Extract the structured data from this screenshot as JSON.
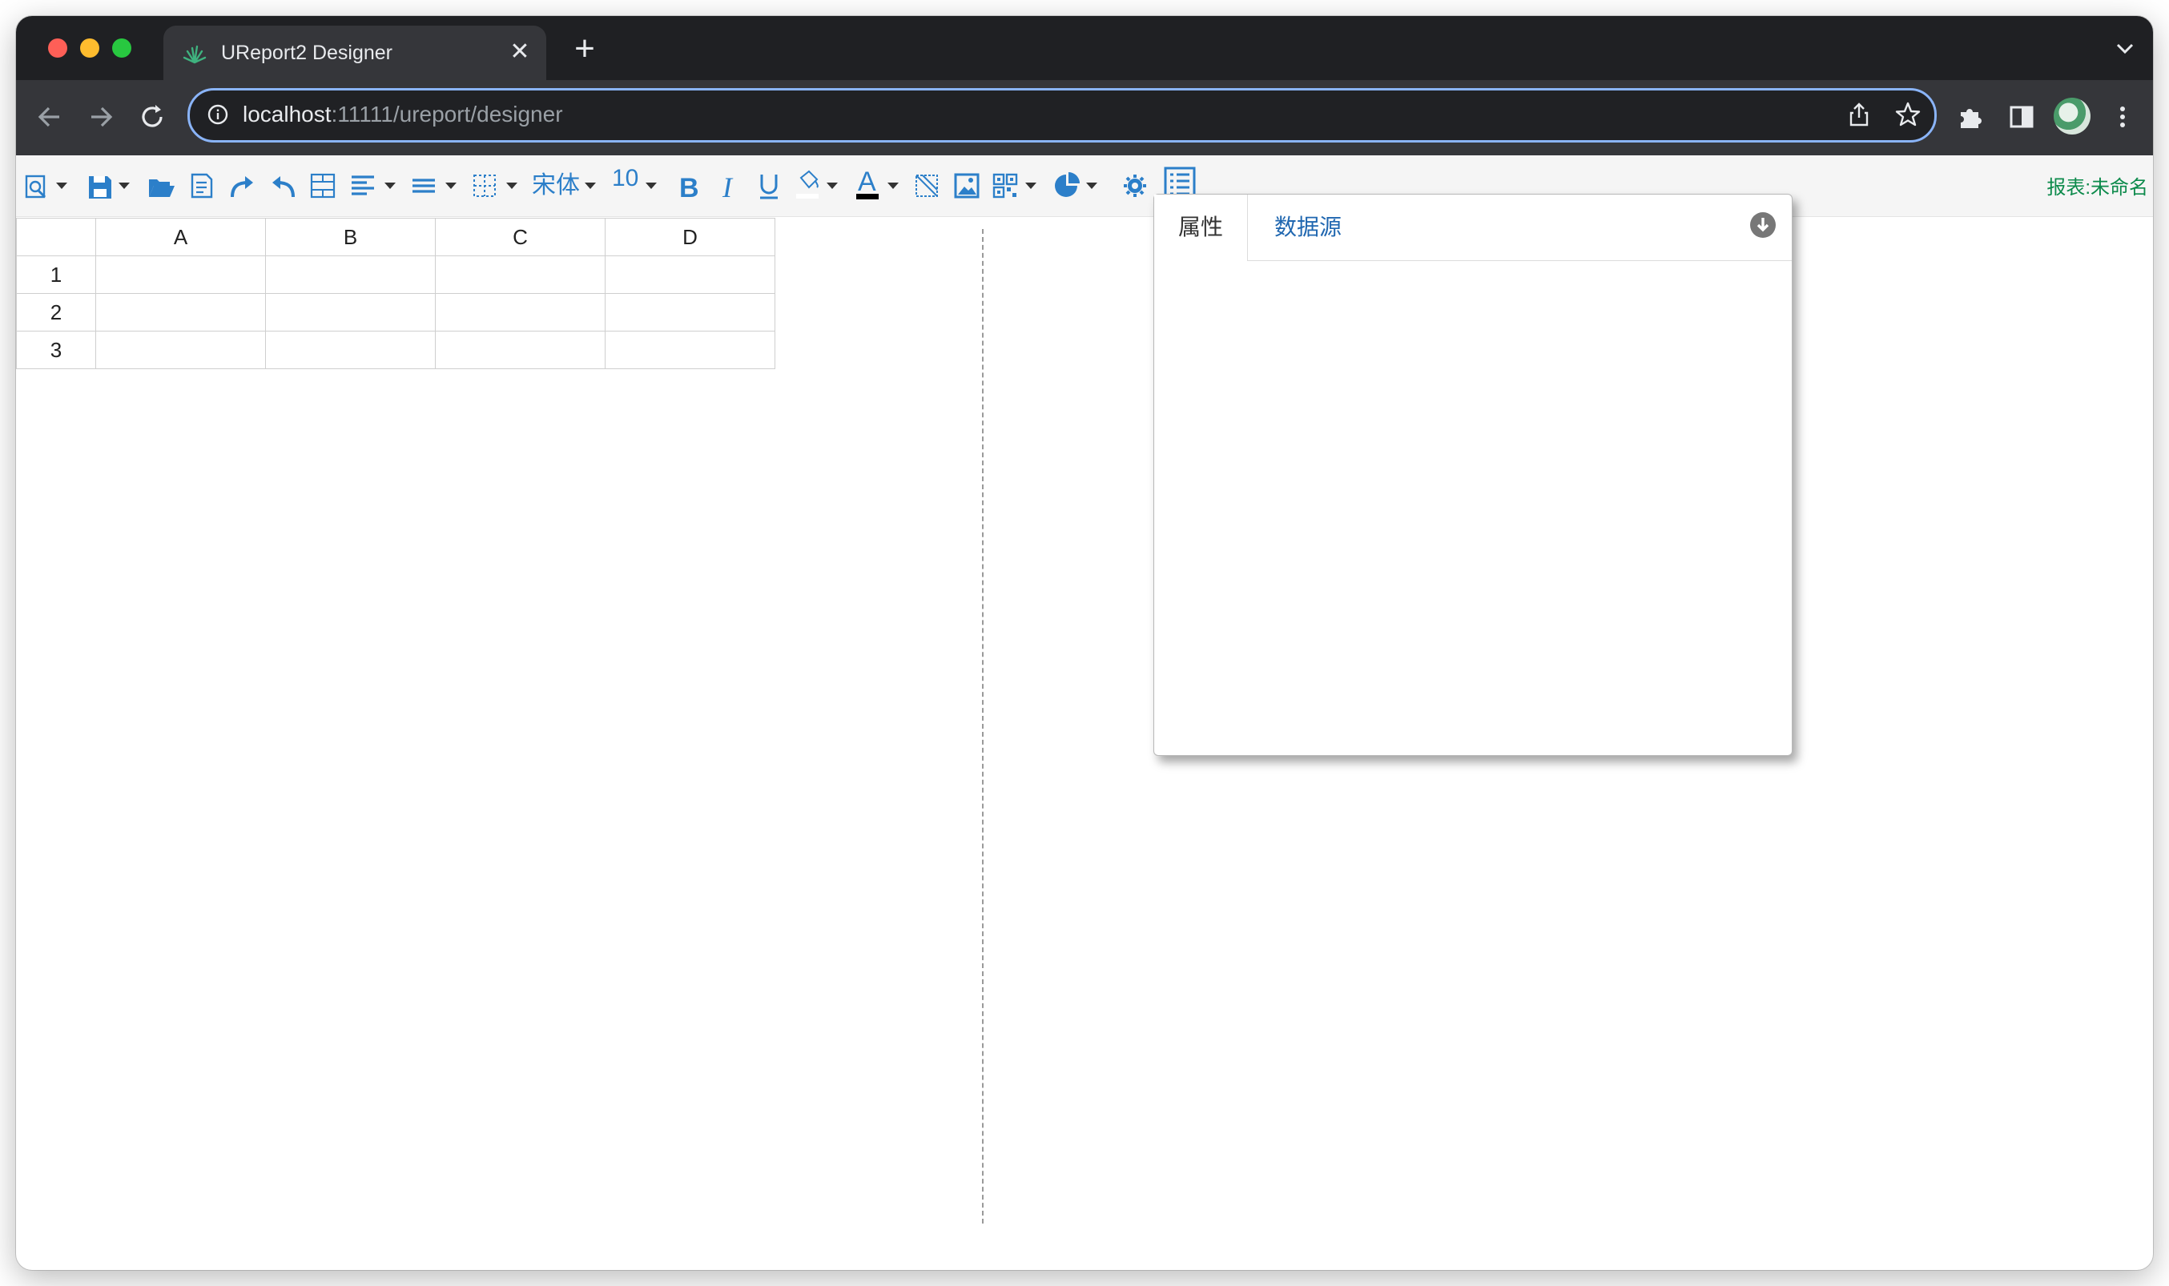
{
  "browser": {
    "tab_title": "UReport2 Designer",
    "url_host": "localhost",
    "url_path": ":11111/ureport/designer"
  },
  "toolbar": {
    "font_name": "宋体",
    "font_size": "10",
    "report_name": "报表:未命名"
  },
  "grid": {
    "columns": [
      "A",
      "B",
      "C",
      "D"
    ],
    "rows": [
      "1",
      "2",
      "3"
    ]
  },
  "panel": {
    "tab_properties": "属性",
    "tab_datasource": "数据源"
  },
  "colors": {
    "toolbar_icon": "#2c7fc9",
    "report_name": "#0c8a4b",
    "omnibox_border": "#8ab4f8"
  }
}
